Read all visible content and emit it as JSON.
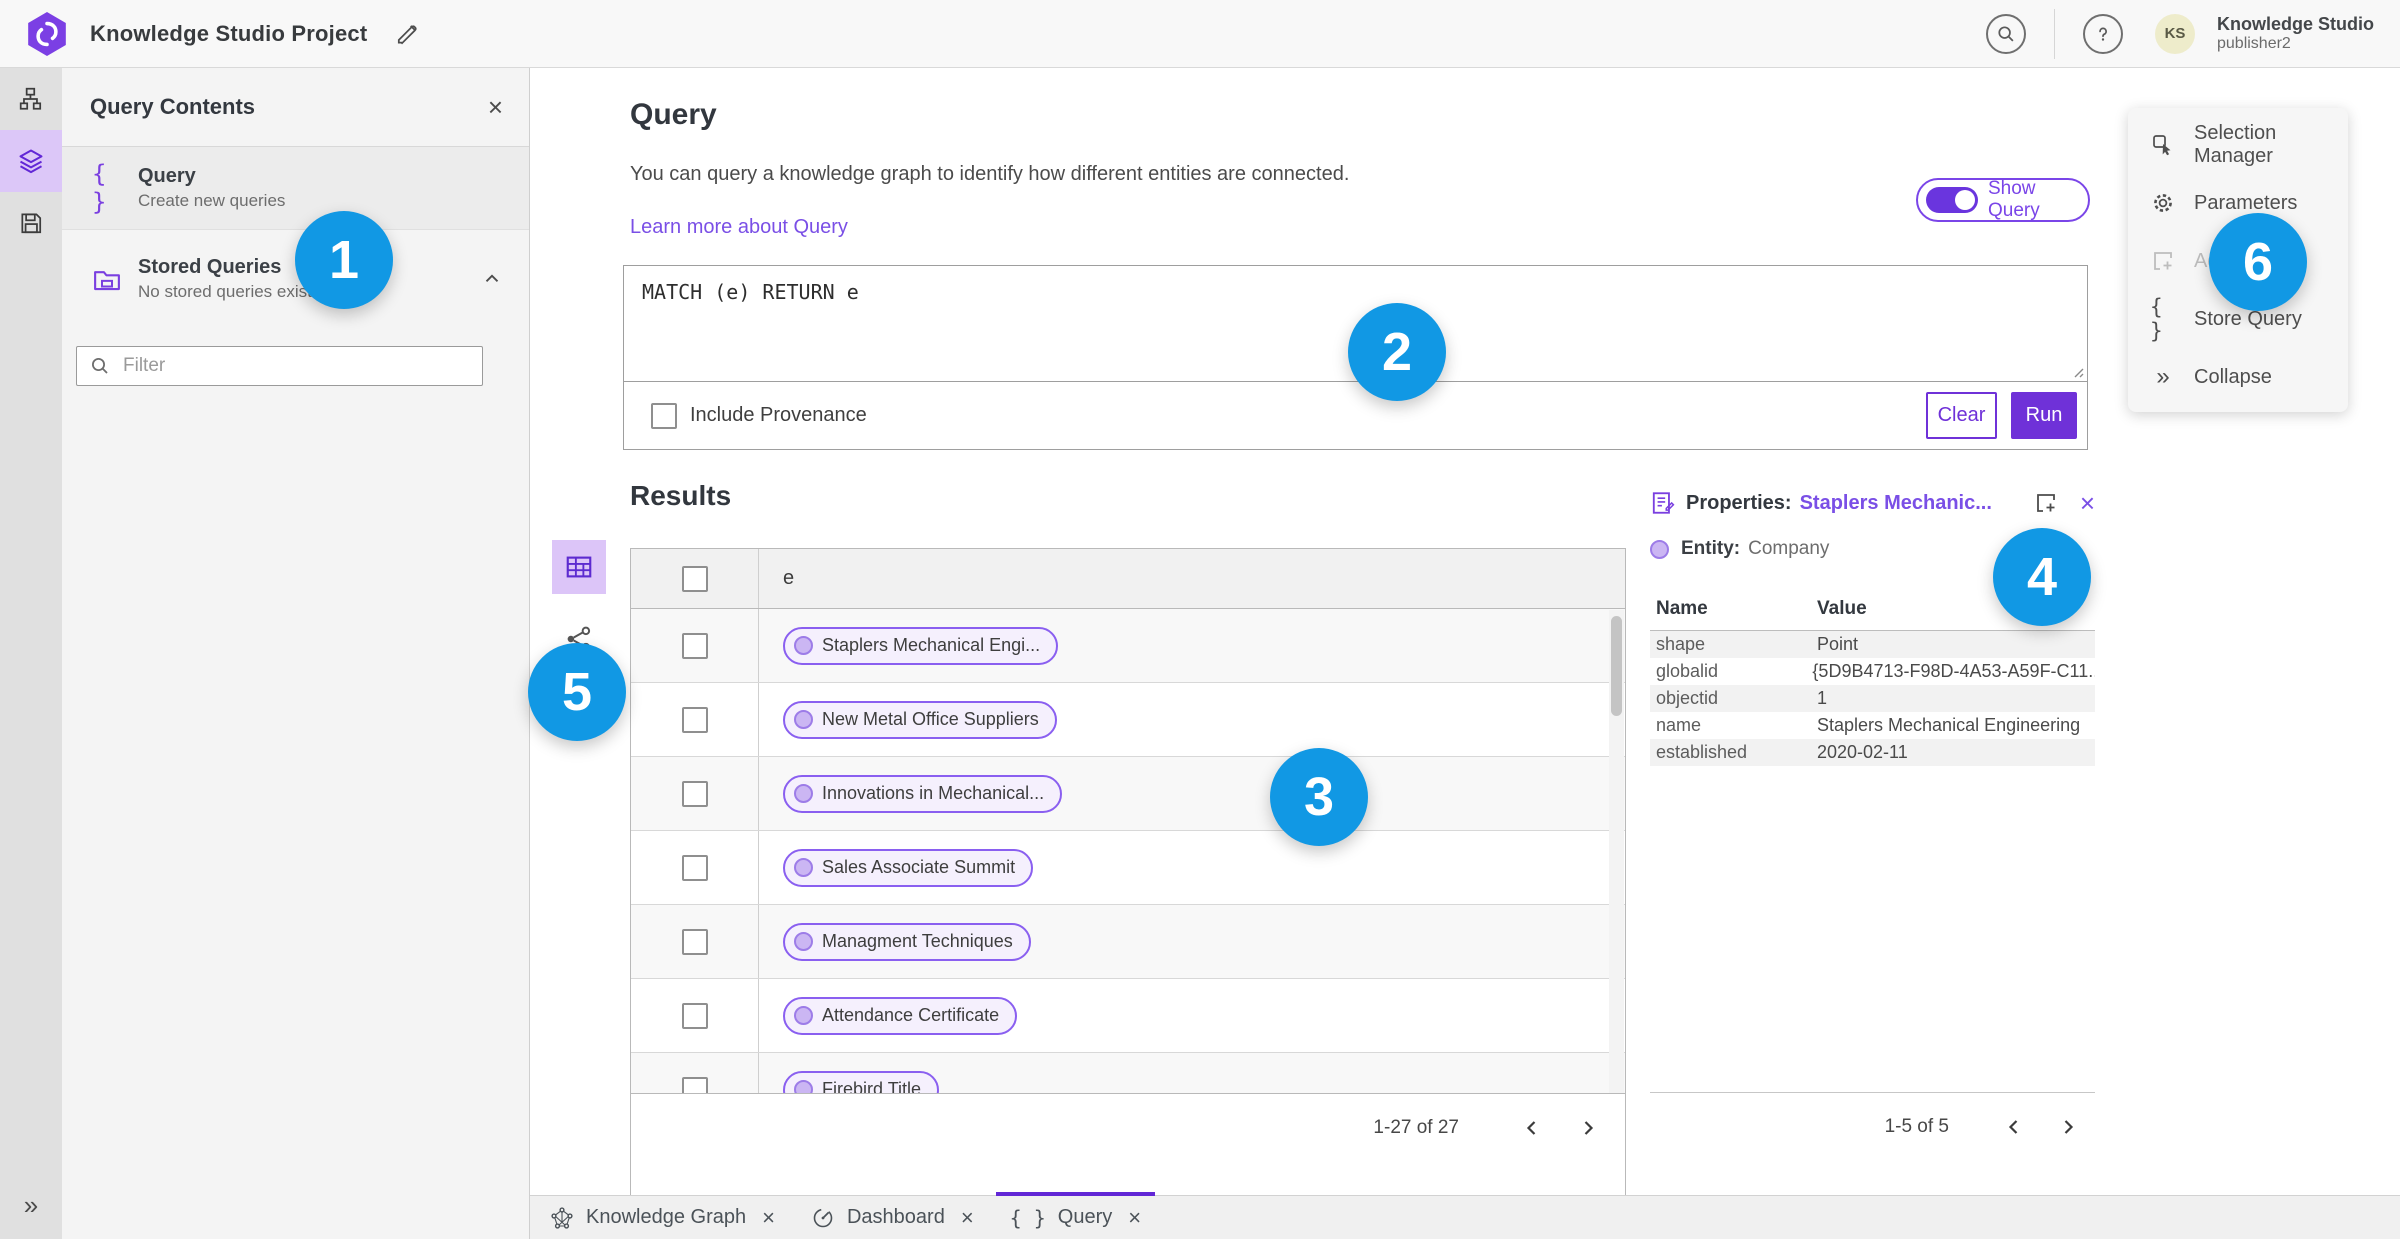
{
  "icons": {
    "close": "×",
    "braces": "{ }",
    "double_chevron": "»"
  },
  "topbar": {
    "app_title": "Knowledge Studio Project",
    "user_name": "Knowledge Studio",
    "user_role": "publisher2",
    "avatar_initials": "KS"
  },
  "contents_panel": {
    "title": "Query Contents",
    "query_item": {
      "title": "Query",
      "subtitle": "Create new queries"
    },
    "stored_queries": {
      "title": "Stored Queries",
      "subtitle": "No stored queries exist"
    },
    "filter_placeholder": "Filter"
  },
  "query_section": {
    "heading": "Query",
    "description": "You can query a knowledge graph to identify how different entities are connected.",
    "learn_more_link": "Learn more about Query",
    "show_query_label": "Show Query",
    "query_text": "MATCH (e) RETURN e",
    "include_provenance_label": "Include Provenance",
    "clear_button": "Clear",
    "run_button": "Run"
  },
  "results": {
    "heading": "Results",
    "column_header": "e",
    "rows": [
      "Staplers Mechanical Engi...",
      "New Metal Office Suppliers",
      "Innovations in Mechanical...",
      "Sales Associate Summit",
      "Managment Techniques",
      "Attendance Certificate",
      "Firebird Title"
    ],
    "pagination": "1-27 of 27"
  },
  "properties_panel": {
    "title_label": "Properties:",
    "selected_entity": "Staplers Mechanic...",
    "entity_label": "Entity:",
    "entity_type": "Company",
    "name_column": "Name",
    "value_column": "Value",
    "rows": [
      {
        "name": "shape",
        "value": "Point"
      },
      {
        "name": "globalid",
        "value": "{5D9B4713-F98D-4A53-A59F-C11..."
      },
      {
        "name": "objectid",
        "value": "1"
      },
      {
        "name": "name",
        "value": "Staplers Mechanical Engineering"
      },
      {
        "name": "established",
        "value": "2020-02-11"
      }
    ],
    "pagination": "1-5 of 5"
  },
  "action_menu": {
    "items": [
      "Selection Manager",
      "Parameters",
      "Ad",
      "Store Query",
      "Collapse"
    ]
  },
  "bottom_tabs": [
    "Knowledge Graph",
    "Dashboard",
    "Query"
  ],
  "annotations": [
    "1",
    "2",
    "3",
    "4",
    "5",
    "6"
  ],
  "colors": {
    "accent_purple": "#6f31d8",
    "annotation_blue": "#1198e4"
  }
}
